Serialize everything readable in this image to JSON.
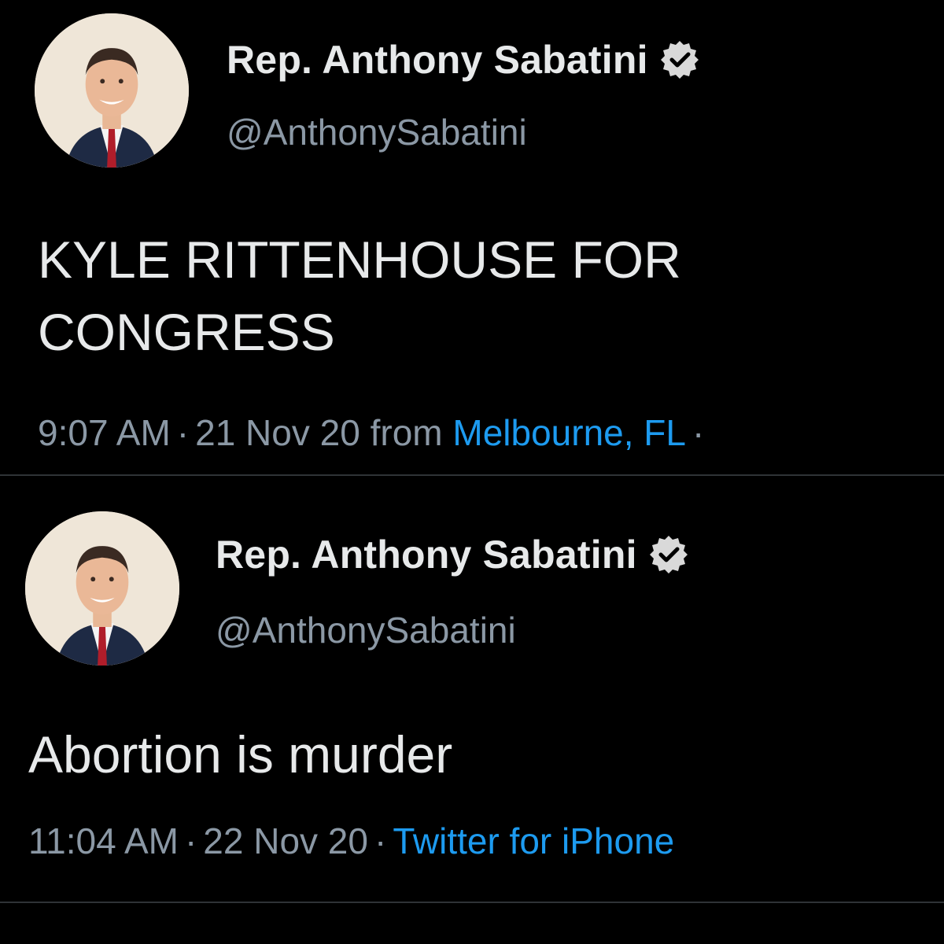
{
  "colors": {
    "background": "#000000",
    "primary_text": "#e7e9ea",
    "secondary_text": "#8b98a5",
    "link": "#1d9bf0",
    "divider": "#2f3336"
  },
  "tweets": [
    {
      "display_name": "Rep. Anthony Sabatini",
      "handle": "@AnthonySabatini",
      "verified_icon": "verified-badge-icon",
      "text": "KYLE RITTENHOUSE FOR\nCONGRESS",
      "time": "9:07 AM",
      "separator": "·",
      "date": "21 Nov 20",
      "from_label": "from",
      "source": "Melbourne, FL",
      "trailing_separator": "·"
    },
    {
      "display_name": "Rep. Anthony Sabatini",
      "handle": "@AnthonySabatini",
      "verified_icon": "verified-badge-icon",
      "text": "Abortion is murder",
      "time": "11:04 AM",
      "separator": "·",
      "date": "22 Nov 20",
      "source": "Twitter for iPhone"
    }
  ]
}
